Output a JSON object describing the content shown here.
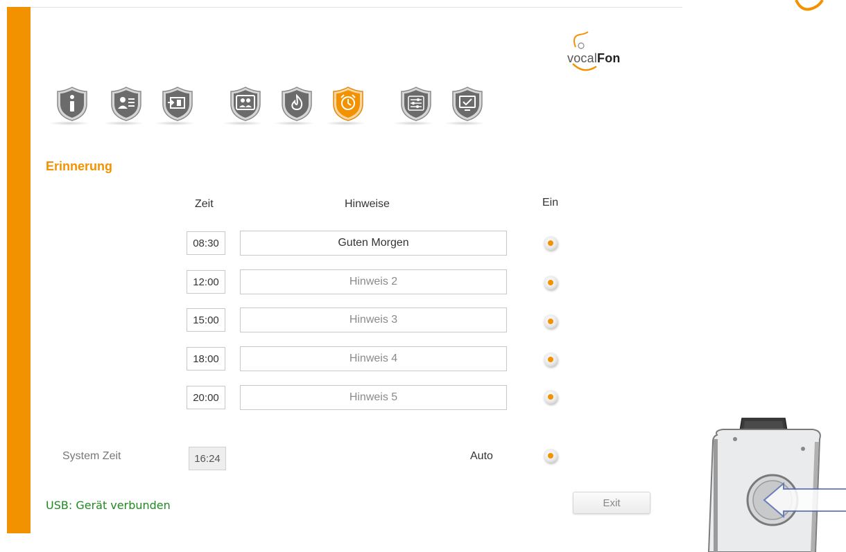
{
  "brand": {
    "logo_light": "vocal",
    "logo_bold": "Fon"
  },
  "nav": {
    "items": [
      {
        "icon": "info-icon",
        "active": false
      },
      {
        "icon": "contact-card-icon",
        "active": false
      },
      {
        "icon": "transfer-icon",
        "active": false
      },
      {
        "icon": "contacts-group-icon",
        "active": false
      },
      {
        "icon": "fire-icon",
        "active": false
      },
      {
        "icon": "alarm-clock-icon",
        "active": true
      },
      {
        "icon": "sliders-icon",
        "active": false
      },
      {
        "icon": "monitor-check-icon",
        "active": false
      }
    ]
  },
  "section": {
    "title": "Erinnerung"
  },
  "table": {
    "headers": {
      "time": "Zeit",
      "notes": "Hinweise",
      "on": "Ein"
    },
    "rows": [
      {
        "time": "08:30",
        "note": "Guten Morgen",
        "on": true
      },
      {
        "time": "12:00",
        "note": "Hinweis 2",
        "on": true
      },
      {
        "time": "15:00",
        "note": "Hinweis 3",
        "on": true
      },
      {
        "time": "18:00",
        "note": "Hinweis 4",
        "on": true
      },
      {
        "time": "20:00",
        "note": "Hinweis 5",
        "on": true
      }
    ]
  },
  "system": {
    "label": "System Zeit",
    "time": "16:24",
    "auto_label": "Auto",
    "auto_on": true
  },
  "status": {
    "usb": "USB: Gerät verbunden"
  },
  "buttons": {
    "exit": "Exit"
  },
  "colors": {
    "accent": "#f39200",
    "status_ok": "#1f8a1f",
    "icon_grey": "#6b6b6b"
  }
}
